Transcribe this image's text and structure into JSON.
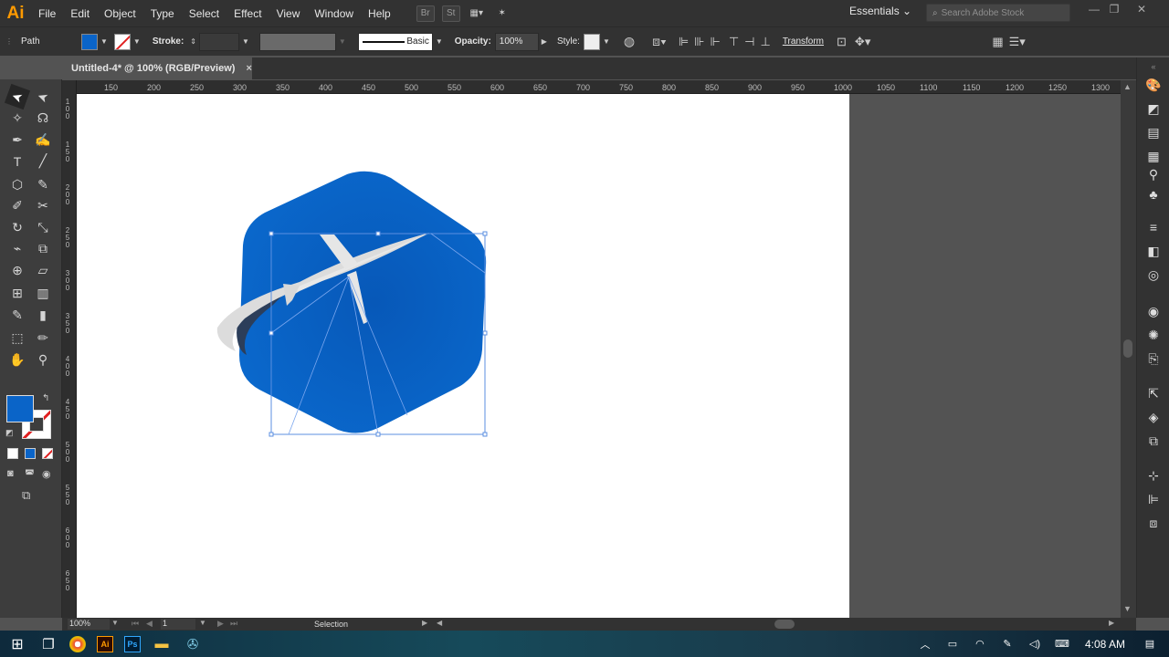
{
  "app": {
    "logo": "Ai"
  },
  "menu": [
    "File",
    "Edit",
    "Object",
    "Type",
    "Select",
    "Effect",
    "View",
    "Window",
    "Help"
  ],
  "menubar_icons": {
    "bridge": "Br",
    "stock": "St"
  },
  "workspace": "Essentials",
  "search": {
    "placeholder": "Search Adobe Stock"
  },
  "control": {
    "object_type": "Path",
    "fill_color": "#0a64c8",
    "stroke_label": "Stroke:",
    "brush_label": "Basic",
    "opacity_label": "Opacity:",
    "opacity_value": "100%",
    "style_label": "Style:",
    "transform_label": "Transform"
  },
  "document": {
    "tab_title": "Untitled-4* @ 100% (RGB/Preview)",
    "close": "×"
  },
  "ruler_top": [
    "150",
    "200",
    "250",
    "300",
    "350",
    "400",
    "450",
    "500",
    "550",
    "600",
    "650",
    "700",
    "750",
    "800",
    "850",
    "900",
    "950",
    "1000",
    "1050",
    "1100",
    "1150",
    "1200",
    "1250",
    "1300"
  ],
  "ruler_left": [
    "100",
    "150",
    "200",
    "250",
    "300",
    "350",
    "400",
    "450",
    "500",
    "550",
    "600",
    "650"
  ],
  "status": {
    "zoom": "100%",
    "artboard_num": "1",
    "mode": "Selection"
  },
  "taskbar": {
    "time": "4:08 AM"
  },
  "colors": {
    "hex_blue": "#0a64c8",
    "light_grey": "#dcdcdc",
    "dark_swoosh": "#2c3e5a"
  }
}
